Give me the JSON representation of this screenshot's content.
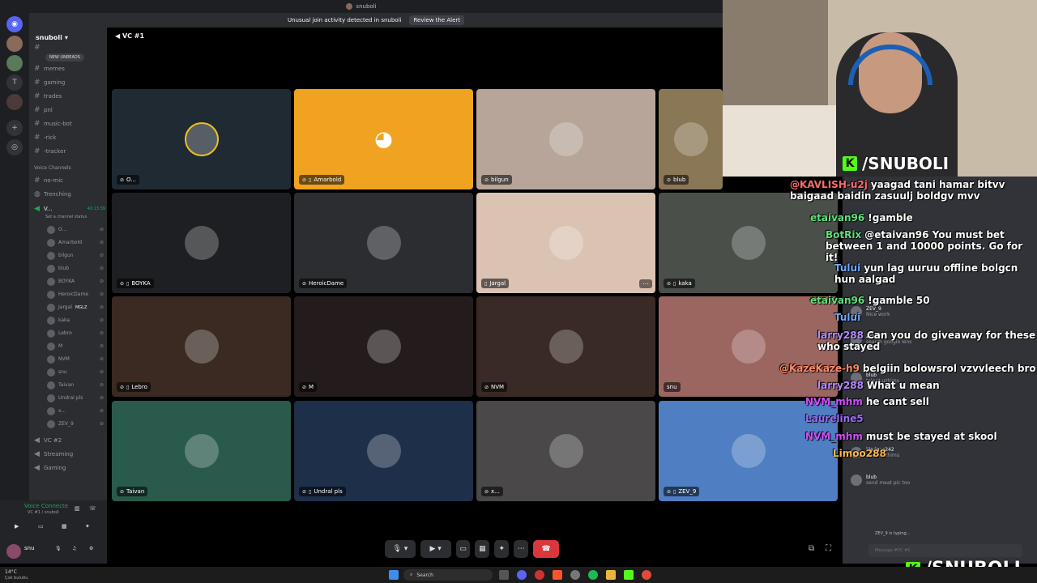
{
  "window": {
    "title": "snuboli",
    "alert_text": "Unusual join activity detected in snuboli",
    "alert_button": "Review the Alert"
  },
  "server": {
    "name": "snuboli",
    "new_unreads": "NEW UNREADS",
    "text_channels": [
      "memes",
      "gaming",
      "trades",
      "pnl",
      "music-bot",
      "-rick",
      "-tracker"
    ],
    "voice_section": "Voice Channels",
    "voice_channels_top": [
      "no-mic",
      "Trenching"
    ],
    "active_vc": "V...",
    "active_vc_timer": "40:13:39",
    "active_vc_status": "Set a channel status",
    "voice_users": [
      "O...",
      "Amarbold",
      "bilgun",
      "blub",
      "BOYKA",
      "HeroicDame",
      "Jargal",
      "kaka",
      "Lebro",
      "M",
      "NVM",
      "snu",
      "Taivan",
      "Undral pls",
      "x...",
      "ZEV_9"
    ],
    "jargal_badge": "MGLZ",
    "voice_channels_bottom": [
      "VC #2",
      "Streaming",
      "Gaming"
    ]
  },
  "voice_connect": {
    "title": "Voice Connecte",
    "subtitle": "VC #1 / snuboli"
  },
  "user_panel": {
    "name": "snu",
    "status": "Çok bulutlu",
    "weather": "14°C"
  },
  "call": {
    "title": "VC #1",
    "tiles": [
      {
        "name": "O...",
        "bg": "#1f2a33",
        "ring": "#f0c020",
        "muted": true
      },
      {
        "name": "Amarbold",
        "bg": "#f0a320",
        "discord": true,
        "muted": true,
        "mobile": true
      },
      {
        "name": "bilgun",
        "bg": "#b6a598",
        "muted": true
      },
      {
        "name": "blub",
        "bg": "#8a7755",
        "muted": true
      },
      {
        "name": "BOYKA",
        "bg": "#1e1f22",
        "muted": true,
        "mobile": true
      },
      {
        "name": "HeroicDame",
        "bg": "#2b2d31",
        "muted": true
      },
      {
        "name": "Jargal",
        "bg": "#dbc3b3",
        "mobile": true
      },
      {
        "name": "kaka",
        "bg": "#4a4f4a",
        "muted": true,
        "mobile": true
      },
      {
        "name": "Lebro",
        "bg": "#3a2a22",
        "muted": true,
        "mobile": true
      },
      {
        "name": "M",
        "bg": "#241c1c",
        "muted": true
      },
      {
        "name": "NVM",
        "bg": "#3a2a26",
        "muted": true
      },
      {
        "name": "snu",
        "bg": "#9b6560"
      },
      {
        "name": "Taivan",
        "bg": "#2a5a4c",
        "muted": true
      },
      {
        "name": "Undral pls",
        "bg": "#1e2f4a",
        "muted": true,
        "mobile": true
      },
      {
        "name": "x...",
        "bg": "#4a4848",
        "muted": true
      },
      {
        "name": "ZEV_9",
        "bg": "#4f7fc2",
        "muted": true,
        "mobile": true
      }
    ]
  },
  "brand": {
    "top": "/SNUBOLI",
    "bottom": "/SNUBOLI",
    "k": "K"
  },
  "stream_chat": [
    {
      "user": "@KAVLISH-u2j",
      "color": "#ff6b6b",
      "text": "yaagad tani hamar bitvv baigaad baidin zasuulj boldgv mvv"
    },
    {
      "user": "etaivan96",
      "color": "#5ee07a",
      "text": "!gamble"
    },
    {
      "user": "BotRix",
      "color": "#5ee07a",
      "text": "@etaivan96 You must bet between 1 and 10000 points. Go for it!"
    },
    {
      "user": "Tului",
      "color": "#6fa8ff",
      "text": "yun lag uuruu offline bolgcn hun aalgad"
    },
    {
      "user": "etaivan96",
      "color": "#5ee07a",
      "text": "!gamble 50"
    },
    {
      "user": "Tului",
      "color": "#6fa8ff",
      "text": ""
    },
    {
      "user": "larry288",
      "color": "#b58bff",
      "text": "Can you do giveaway for these who stayed"
    },
    {
      "user": "@KazeKaze-h9",
      "color": "#ff8a65",
      "text": "belgiin bolowsrol vzvvleech bro"
    },
    {
      "user": "larry288",
      "color": "#b58bff",
      "text": "What u mean"
    },
    {
      "user": "NVM_mhm",
      "color": "#d04fff",
      "text": "he cant sell"
    },
    {
      "user": "Laureline5",
      "color": "#9c6bff",
      "text": ""
    },
    {
      "user": "NVM_mhm",
      "color": "#d04fff",
      "text": "must be stayed at skool"
    },
    {
      "user": "Limoo288",
      "color": "#ffb84a",
      "text": ""
    }
  ],
  "text_chat": [
    {
      "user": "ZEV_9",
      "msg": "Nice work"
    },
    {
      "user": "ZEV_9",
      "msg": "search google lens"
    },
    {
      "user": "blub",
      "msg": "talent uzhimu"
    },
    {
      "user": "Madgas242",
      "msg": "talent uzhimu"
    },
    {
      "user": "blub",
      "msg": "send meat pic too"
    }
  ],
  "typing": "ZEV_9 is typing...",
  "message_placeholder": "Message #VC #1",
  "taskbar": {
    "search": "Search"
  }
}
